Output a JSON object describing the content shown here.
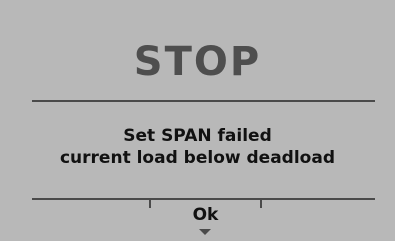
{
  "dialog": {
    "title": "STOP",
    "message_line1": "Set SPAN failed",
    "message_line2": "current load below deadload"
  },
  "softkeys": {
    "ok_label": "Ok",
    "ok_icon": "arrow-down-icon"
  },
  "colors": {
    "background": "#b8b8b8",
    "title": "#4e4e4e",
    "text": "#111111",
    "rule": "#4a4a4a"
  }
}
